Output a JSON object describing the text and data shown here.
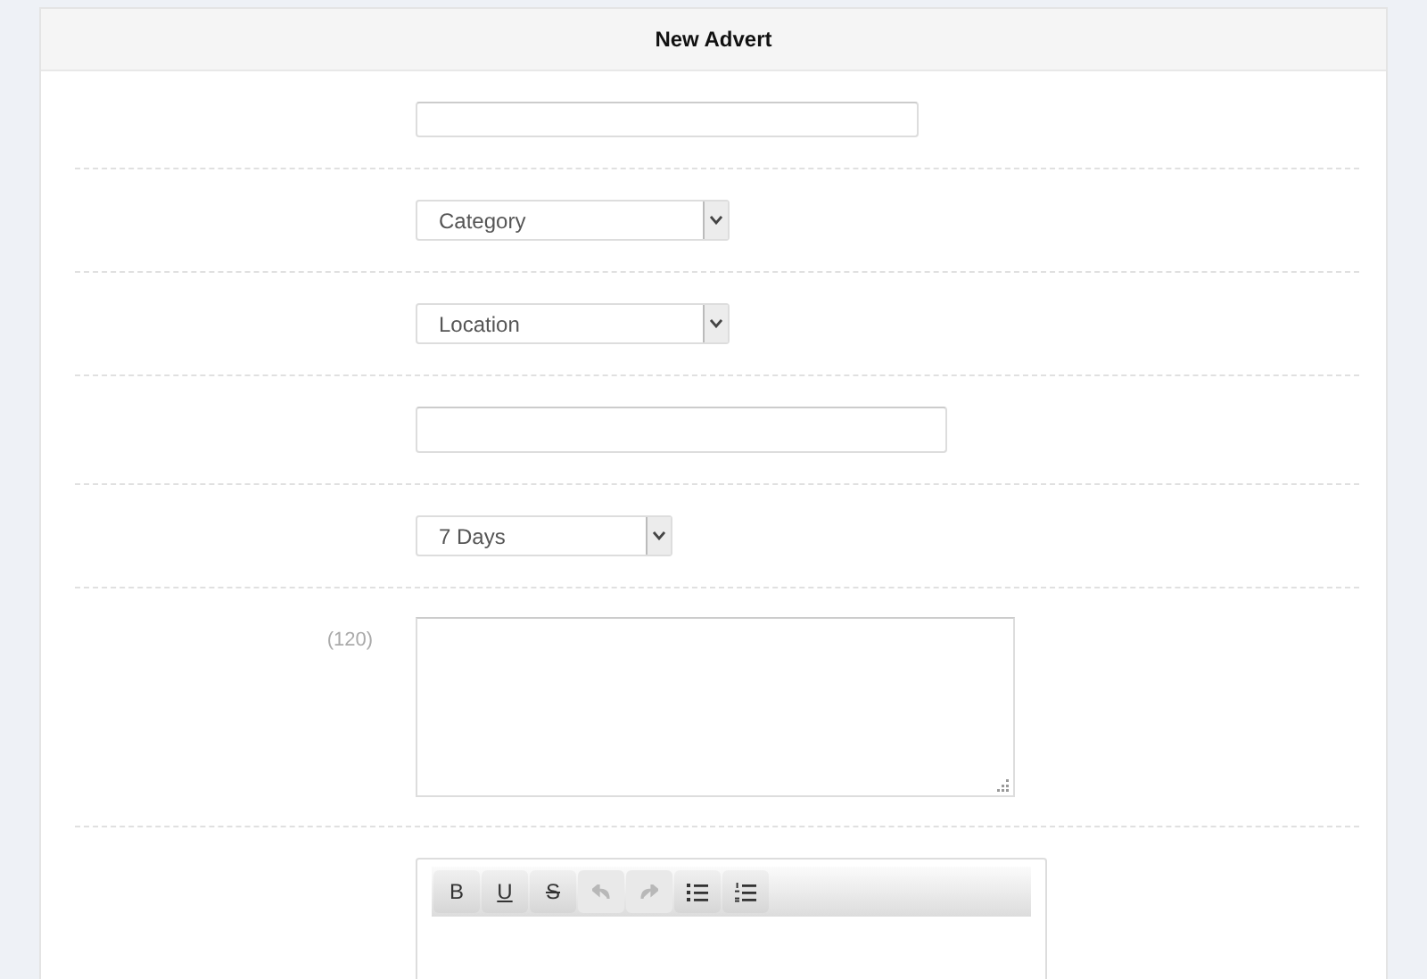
{
  "form": {
    "title": "New Advert",
    "fields": [
      {
        "kind": "text"
      },
      {
        "kind": "select",
        "value": "Category"
      },
      {
        "kind": "select",
        "value": "Location"
      },
      {
        "kind": "text"
      },
      {
        "kind": "select",
        "value": "7 Days"
      },
      {
        "kind": "textarea",
        "hint": "(120)"
      },
      {
        "kind": "editor",
        "toolbar": [
          {
            "kind": "bold",
            "label": "B",
            "disabled": false
          },
          {
            "kind": "underline",
            "label": "U",
            "disabled": false
          },
          {
            "kind": "strike",
            "label": "S",
            "disabled": false
          },
          {
            "kind": "undo",
            "disabled": true
          },
          {
            "kind": "redo",
            "disabled": true
          },
          {
            "kind": "bullets",
            "disabled": false
          },
          {
            "kind": "numbers",
            "disabled": false
          }
        ]
      }
    ]
  }
}
